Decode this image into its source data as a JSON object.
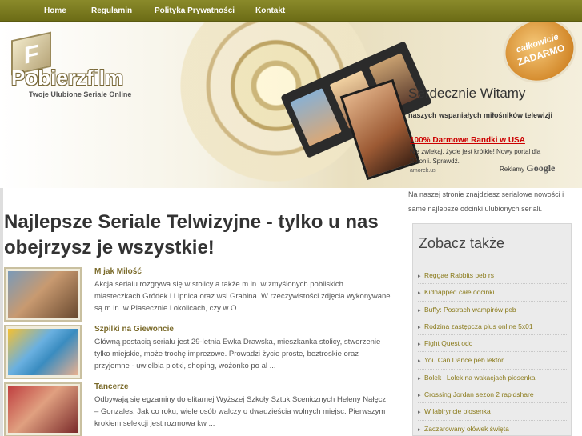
{
  "nav": {
    "items": [
      "Home",
      "Regulamin",
      "Polityka Prywatności",
      "Kontakt"
    ]
  },
  "header": {
    "logo_text": "Pobierzfilm",
    "logo_letter": "F",
    "tagline": "Twoje Ulubione Seriale Online",
    "badge_line1": "całkowicie",
    "badge_line2": "ZADARMO"
  },
  "welcome": {
    "title": "Serdecznie Witamy",
    "subtitle": "naszych wspaniałych miłośników telewizji",
    "intro": "Na naszej stronie znajdziesz serialowe nowości i same najlepsze odcinki ulubionych seriali."
  },
  "ad": {
    "title": "100% Darmowe Randki w USA",
    "text": "Nie zwlekaj, życie jest krótkie! Nowy portal dla Polonii. Sprawdź.",
    "url": "amorek.us",
    "label": "Reklamy",
    "brand": "Google"
  },
  "main": {
    "heading": "Najlepsze Seriale Telwizyjne - tylko u nas obejrzysz je wszystkie!",
    "articles": [
      {
        "title": "M jak Miłość",
        "text": "Akcja serialu rozgrywa się w stolicy a także m.in. w zmyślonych pobliskich miasteczkach Gródek i Lipnica oraz wsi Grabina. W rzeczywistości zdjęcia wykonywane są m.in. w Piasecznie i okolicach, czy w O ..."
      },
      {
        "title": "Szpilki na Giewoncie",
        "text": "Główną postacią serialu jest 29-letnia Ewka Drawska, mieszkanka stolicy, stworzenie tylko miejskie, może trochę imprezowe. Prowadzi życie proste, beztroskie oraz przyjemne - uwielbia plotki, shoping, wożonko po al ..."
      },
      {
        "title": "Tancerze",
        "text": "Odbywają się egzaminy do elitarnej Wyższej Szkoły Sztuk Scenicznych Heleny Nałęcz – Gonzales. Jak co roku, wiele osób walczy o dwadzieścia wolnych miejsc. Pierwszym krokiem selekcji jest rozmowa kw ..."
      }
    ]
  },
  "sidebar": {
    "title": "Zobacz także",
    "links": [
      "Reggae Rabbits peb rs",
      "Kidnapped całe odcinki",
      "Buffy: Postrach wampirów peb",
      "Rodzina zastępcza plus online 5x01",
      "Fight Quest odc",
      "You Can Dance peb lektor",
      "Bolek i Lolek na wakacjach piosenka",
      "Crossing Jordan sezon 2 rapidshare",
      "W labiryncie piosenka",
      "Zaczarowany ołówek święta"
    ]
  },
  "colors": {
    "nav_bg": "#7a7a20",
    "link_color": "#8a7a1a",
    "ad_title": "#cc0000",
    "sidebar_bg": "#ebebeb"
  },
  "icons": {
    "list_bullet": "bullet-icon",
    "logo": "film-logo-icon"
  }
}
